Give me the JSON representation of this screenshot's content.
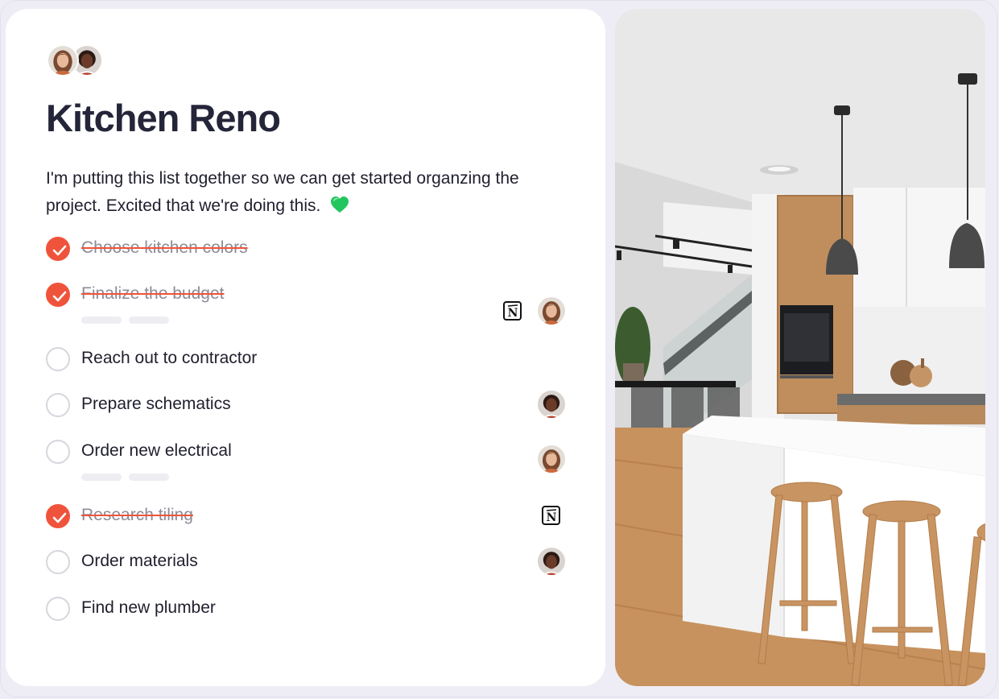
{
  "page": {
    "title": "Kitchen Reno",
    "description": "I'm putting this list together so we can get started organzing the project. Excited that we're doing this.",
    "description_emoji": "green-heart-icon"
  },
  "collaborators": [
    "avatar-woman",
    "avatar-man"
  ],
  "tasks": [
    {
      "label": "Choose kitchen colors",
      "done": true,
      "assignees": [],
      "pills": false
    },
    {
      "label": "Finalize the budget",
      "done": true,
      "assignees": [
        "notion-icon",
        "avatar-woman"
      ],
      "pills": true
    },
    {
      "label": "Reach out to contractor",
      "done": false,
      "assignees": [],
      "pills": false
    },
    {
      "label": "Prepare schematics",
      "done": false,
      "assignees": [
        "avatar-man"
      ],
      "pills": false
    },
    {
      "label": "Order new electrical",
      "done": false,
      "assignees": [
        "avatar-woman"
      ],
      "pills": true
    },
    {
      "label": "Research tiling",
      "done": true,
      "assignees": [
        "notion-icon"
      ],
      "pills": false
    },
    {
      "label": "Order materials",
      "done": false,
      "assignees": [
        "avatar-man"
      ],
      "pills": false
    },
    {
      "label": "Find new plumber",
      "done": false,
      "assignees": [],
      "pills": false
    }
  ],
  "colors": {
    "accent": "#f0533b",
    "title": "#25253a",
    "done_text": "#8c8c98",
    "heart": "#22c55e"
  },
  "photo": "kitchen-interior-image"
}
